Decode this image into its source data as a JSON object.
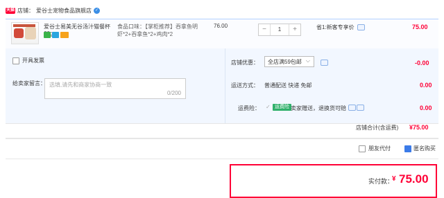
{
  "shop": {
    "label": "店铺：",
    "name": "爱谷士宠物食品旗舰店",
    "badge": "天猫",
    "wx": "✓"
  },
  "item": {
    "title": "爱谷士易美无谷汤汁猫餐杯60g...",
    "spec_line1": "食品口味：【掌柜推荐】吞拿鱼明",
    "spec_line2": "虾*2+吞拿鱼*2+鸡肉*2",
    "unit_price": "76.00",
    "qty": "1",
    "minus": "−",
    "plus": "+",
    "discount": "省1:新客专享价",
    "subtotal": "75.00",
    "tag_colors": [
      "#3bb44a",
      "#2aa6df",
      "#f6a31b"
    ]
  },
  "options": {
    "invoice_label": "开具发票",
    "note_label": "给卖家留言：",
    "note_placeholder": "选填,请先和商家协商一致",
    "note_count": "0/200",
    "shop_discount_label": "店铺优惠：",
    "shop_discount_value": "全店满59包邮",
    "shop_discount_amount": "-0.00",
    "shipping_label": "运送方式：",
    "shipping_value": "普通配送 快递 免邮",
    "shipping_amount": "0.00",
    "insurance_label": "运费险：",
    "insurance_badge": "运费险",
    "insurance_text": "卖家赠送，退换货可赔",
    "insurance_amount": "0.00"
  },
  "summary": {
    "total_label": "店铺合计(含运费)",
    "total_value": "¥75.00"
  },
  "footer": {
    "anon_gift": "朋友代付",
    "anon_buy": "匿名购买"
  },
  "pay": {
    "label": "实付款：",
    "currency": "¥",
    "amount": "75.00"
  },
  "colors": {
    "accent": "#ff0036",
    "blue_border": "#b2d1ff",
    "panel": "#f2f7ff"
  }
}
